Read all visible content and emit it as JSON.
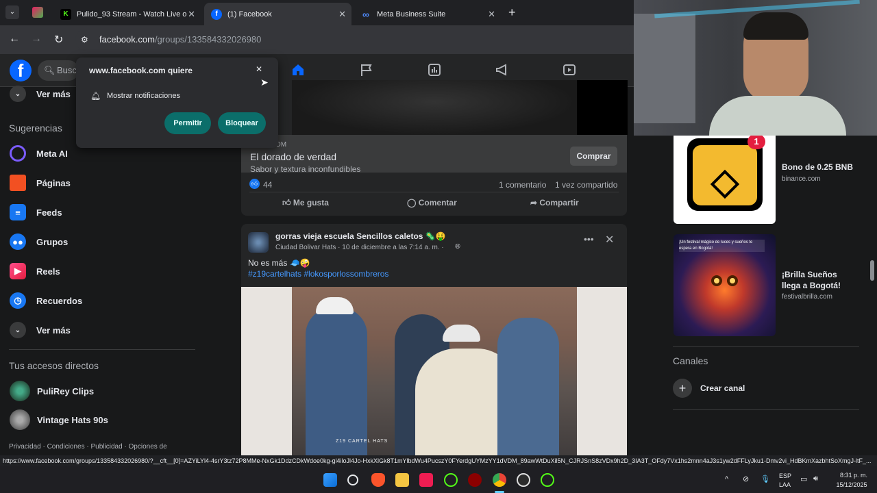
{
  "browser": {
    "tabs": [
      {
        "title": "Pulido_93 Stream - Watch Live on Kic",
        "fav": "K",
        "color": "#53fc18"
      },
      {
        "title": "(1) Facebook",
        "fav": "f",
        "color": "#0866ff"
      },
      {
        "title": "Meta Business Suite",
        "fav": "∞",
        "color": "#0866ff"
      }
    ],
    "new_tab": "+",
    "url_domain": "facebook.com",
    "url_path": "/groups/133584332026980"
  },
  "fb": {
    "search_placeholder": "Busca",
    "sidebar": {
      "ver_mas_top": "Ver más",
      "sugerencias_heading": "Sugerencias",
      "items": [
        {
          "label": "Meta AI",
          "icon": "meta-ai-icon",
          "color": "#7b5cff"
        },
        {
          "label": "Páginas",
          "icon": "flag-icon",
          "color": "#f25022"
        },
        {
          "label": "Feeds",
          "icon": "feeds-icon",
          "color": "#1877f2"
        },
        {
          "label": "Grupos",
          "icon": "groups-icon",
          "color": "#1877f2"
        },
        {
          "label": "Reels",
          "icon": "reels-icon",
          "color": "#e41e3f"
        },
        {
          "label": "Recuerdos",
          "icon": "clock-icon",
          "color": "#1877f2"
        }
      ],
      "ver_mas_bottom": "Ver más",
      "shortcuts_heading": "Tus accesos directos",
      "shortcuts": [
        {
          "label": "PuliRey Clips"
        },
        {
          "label": "Vintage Hats 90s"
        }
      ],
      "footer": "Privacidad · Condiciones · Publicidad · Opciones de"
    },
    "ad_card": {
      "domain_fragment": "OM",
      "title": "El dorado de verdad",
      "subtitle": "Sabor y textura inconfundibles",
      "buy_button": "Comprar",
      "reactions_count": "44",
      "comments": "1 comentario",
      "shares": "1 vez compartido",
      "like": "Me gusta",
      "comment": "Comentar",
      "share": "Compartir"
    },
    "post": {
      "group_name": "gorras vieja escuela Sencillos caletos 🦠🤑",
      "meta": "Ciudad Bolivar Hats · 10 de diciembre a las 7:14 a. m. ·",
      "text": "No es más 🧢🤪",
      "hashtags": "#z19cartelhats #lokosporlossombreros",
      "watermark": "Z19 CARTEL HATS"
    },
    "right": {
      "ads": [
        {
          "title": "Bono de 0.25 BNB",
          "domain": "binance.com"
        },
        {
          "title": "¡Brilla Sueños llega a Bogotá!",
          "domain": "festivalbrilla.com",
          "poster_text": "¡Un festival mágico de luces y sueños te espera en Bogotá!"
        }
      ],
      "channels_heading": "Canales",
      "create_channel": "Crear canal",
      "badge": "1"
    }
  },
  "popup": {
    "title": "www.facebook.com quiere",
    "permission": "Mostrar notificaciones",
    "allow": "Permitir",
    "block": "Bloquear"
  },
  "statusbar": {
    "link": "https://www.facebook.com/groups/133584332026980/?__cft__[0]=AZYiLYl4-4srY3tz72P8MMe-NxGk1DdzCDkWdoe0kg-gl4iloJl4Jo-HxkXlGk8T1mYlbdWu4PucszY0FYerdgUYMzYY1dVDM_89awWtDuXil5N_CJRJSnS8zVDx9h2D_3IA3T_OFdy7Vx1hs2mnn4aJ3s1yw2dFFLyJku1-Dmv2vi_HdBKmXazbhtSoXmgJ-ltF_..."
  },
  "taskbar": {
    "lang_top": "ESP",
    "lang_bottom": "LAA",
    "time": "8:31 p. m.",
    "date": "15/12/2025"
  }
}
